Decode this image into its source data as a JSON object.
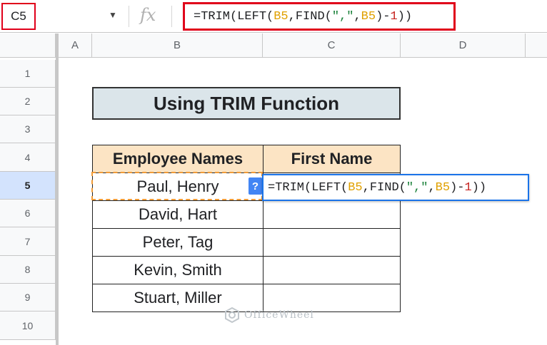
{
  "namebox": {
    "value": "C5",
    "dropdown_icon": "triangle-down-icon"
  },
  "formula_bar": {
    "fx_label": "fx",
    "tokens": [
      {
        "t": "=TRIM(",
        "k": "fn"
      },
      {
        "t": "LEFT(",
        "k": "fn"
      },
      {
        "t": "B5",
        "k": "ref"
      },
      {
        "t": ",FIND(",
        "k": "fn"
      },
      {
        "t": "\"",
        "k": "str"
      },
      {
        "t": ",",
        "k": "str"
      },
      {
        "t": "\"",
        "k": "str"
      },
      {
        "t": ",",
        "k": "fn"
      },
      {
        "t": "B5",
        "k": "ref"
      },
      {
        "t": ")-",
        "k": "fn"
      },
      {
        "t": "1",
        "k": "num"
      },
      {
        "t": "))",
        "k": "fn"
      }
    ]
  },
  "columns": [
    "A",
    "B",
    "C",
    "D"
  ],
  "rows": [
    "1",
    "2",
    "3",
    "4",
    "5",
    "6",
    "7",
    "8",
    "9",
    "10"
  ],
  "active_row": "5",
  "sheet": {
    "title": "Using TRIM Function",
    "headers": {
      "employee_names": "Employee Names",
      "first_name": "First Name"
    },
    "names": [
      "Paul, Henry",
      "David, Hart",
      "Peter, Tag",
      "Kevin, Smith",
      "Stuart, Miller"
    ]
  },
  "cell_editor": {
    "hint": "?",
    "tokens": [
      {
        "t": "=TRIM(",
        "k": "fn"
      },
      {
        "t": "LEFT(",
        "k": "fn"
      },
      {
        "t": "B5",
        "k": "ref"
      },
      {
        "t": ",FIND(",
        "k": "fn"
      },
      {
        "t": "\"",
        "k": "str"
      },
      {
        "t": ",",
        "k": "str"
      },
      {
        "t": "\"",
        "k": "str"
      },
      {
        "t": ",",
        "k": "fn"
      },
      {
        "t": "B5",
        "k": "ref"
      },
      {
        "t": ")-",
        "k": "fn"
      },
      {
        "t": "1",
        "k": "num"
      },
      {
        "t": "))",
        "k": "fn"
      }
    ]
  },
  "colors": {
    "highlight_red": "#e0001a",
    "header_fill": "#fce4c4",
    "title_fill": "#dbe5ea",
    "selection_blue": "#1a73e8",
    "ref_color": "#e0a000"
  },
  "watermark": {
    "text": "OfficeWheel",
    "icon": "officewheel-logo-icon"
  }
}
